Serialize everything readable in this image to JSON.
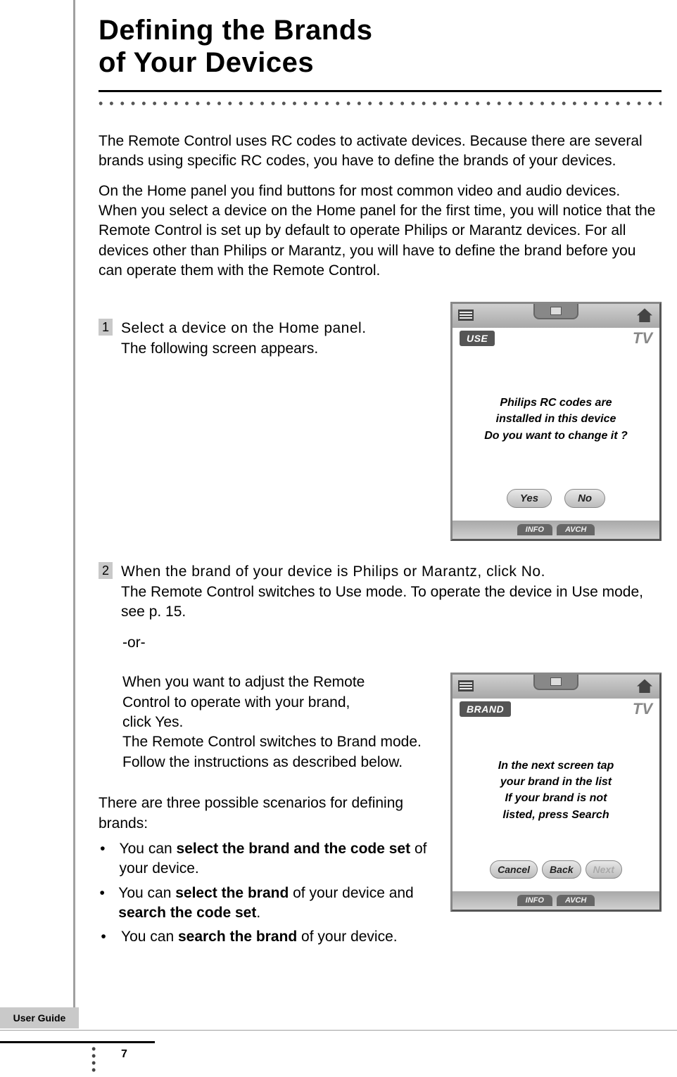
{
  "title_line1": "Defining the Brands",
  "title_line2": "of Your Devices",
  "para1": "The Remote Control uses RC codes to activate devices. Because there are several brands using specific RC codes, you have to define the brands of your devices.",
  "para2": "On the Home panel you find buttons for most common video and audio devices. When you select a device on the Home panel for the first time, you will notice that the Remote Control is set up by default to operate Philips or Marantz devices. For all devices other than Philips or Marantz, you will have to define the brand before you can operate them with the Remote Control.",
  "step1": {
    "num": "1",
    "lead": "Select a device on the Home panel.",
    "rest": "The following screen appears."
  },
  "screen1": {
    "badge": "USE",
    "tv": "TV",
    "msg_l1": "Philips RC codes are",
    "msg_l2": "installed in this device",
    "msg_l3": "Do you want to change it ?",
    "yes": "Yes",
    "no": "No",
    "info": "INFO",
    "avch": "AVCH"
  },
  "step2": {
    "num": "2",
    "lead": "When the brand of your device is Philips or Marantz, click No.",
    "rest": "The Remote Control switches to Use mode. To operate the device in Use mode, see p. 15."
  },
  "or": "-or-",
  "alt": {
    "lead_l1": "When you want to adjust the Remote",
    "lead_l2": "Control to operate with your brand,",
    "lead_l3": "click Yes.",
    "rest_l1": "The Remote Control switches to Brand mode.",
    "rest_l2": "Follow the instructions as described below."
  },
  "screen2": {
    "badge": "BRAND",
    "tv": "TV",
    "msg_l1": "In the next screen tap",
    "msg_l2": "your brand in the list",
    "msg_l3": "If your brand is not",
    "msg_l4": "listed, press Search",
    "cancel": "Cancel",
    "back": "Back",
    "next": "Next",
    "info": "INFO",
    "avch": "AVCH"
  },
  "scenarios_intro": "There are three possible scenarios for defining brands:",
  "bullets": [
    {
      "pre": "You can ",
      "bold": "select the brand and the code set",
      "post": " of your device."
    },
    {
      "pre": "You can ",
      "bold": "select the brand",
      "mid": " of your device and ",
      "bold2": "search the code set",
      "post": "."
    },
    {
      "pre": "You can ",
      "bold": "search the brand",
      "post": " of your device."
    }
  ],
  "footer_tab": "User Guide",
  "page_num": "7"
}
